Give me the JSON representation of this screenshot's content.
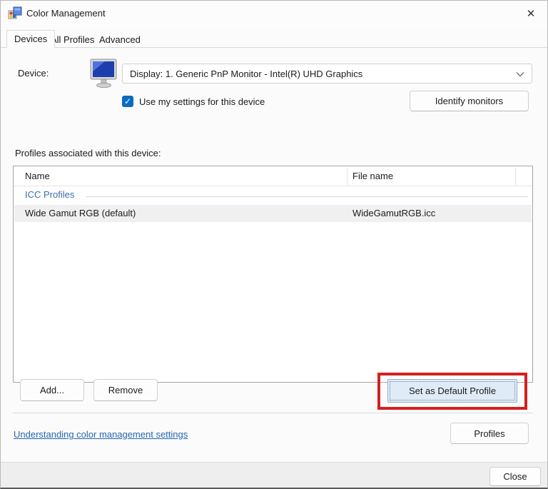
{
  "window": {
    "title": "Color Management"
  },
  "icons": {
    "close_glyph": "✕",
    "check_glyph": "✓"
  },
  "tabs": [
    {
      "label": "Devices",
      "active": true
    },
    {
      "label": "All Profiles",
      "active": false
    },
    {
      "label": "Advanced",
      "active": false
    }
  ],
  "device": {
    "label": "Device:",
    "selected_value": "Display: 1. Generic PnP Monitor - Intel(R) UHD Graphics",
    "checkbox_label": "Use my settings for this device",
    "checkbox_checked": true,
    "identify_button_label": "Identify monitors"
  },
  "profiles": {
    "section_label": "Profiles associated with this device:",
    "columns": [
      "Name",
      "File name"
    ],
    "group_label": "ICC Profiles",
    "rows": [
      {
        "name": "Wide Gamut RGB (default)",
        "file": "WideGamutRGB.icc"
      }
    ],
    "add_button_label": "Add...",
    "remove_button_label": "Remove",
    "set_default_button_label": "Set as Default Profile"
  },
  "bottom": {
    "help_link_label": "Understanding color management settings",
    "profiles_button_label": "Profiles",
    "close_button_label": "Close"
  },
  "colors": {
    "accent_blue": "#0b6bc2",
    "link_blue": "#2567af",
    "group_header_blue": "#3c6ea5",
    "annotation_red": "#d32020",
    "selected_row_gray": "#f0f0f0",
    "set_default_button_bg": "#dfecf8"
  }
}
